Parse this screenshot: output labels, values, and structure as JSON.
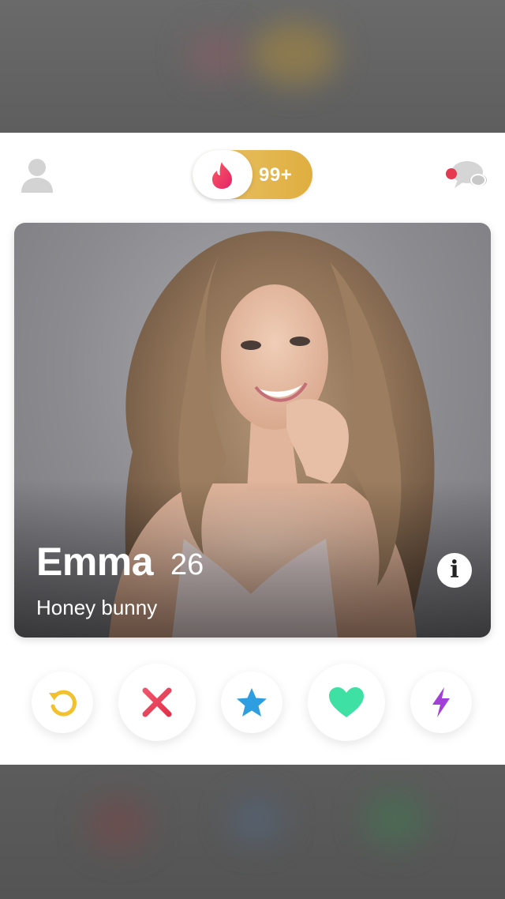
{
  "header": {
    "profile_icon": "person-icon",
    "likes_count": "99+",
    "flame_icon": "flame-icon",
    "messages_icon": "chat-bubbles-icon",
    "accent_color": "#e9c36a",
    "notification_color": "#e5394f"
  },
  "card": {
    "name": "Emma",
    "age": "26",
    "bio": "Honey bunny",
    "info_icon": "info-icon"
  },
  "actions": [
    {
      "name": "rewind",
      "icon": "rewind-icon",
      "color": "#f2c12e"
    },
    {
      "name": "nope",
      "icon": "close-x-icon",
      "color": "#e8475b"
    },
    {
      "name": "super-like",
      "icon": "star-icon",
      "color": "#2d9ee0"
    },
    {
      "name": "like",
      "icon": "heart-icon",
      "color": "#3fe0a4"
    },
    {
      "name": "boost",
      "icon": "lightning-icon",
      "color": "#a23fd8"
    }
  ]
}
